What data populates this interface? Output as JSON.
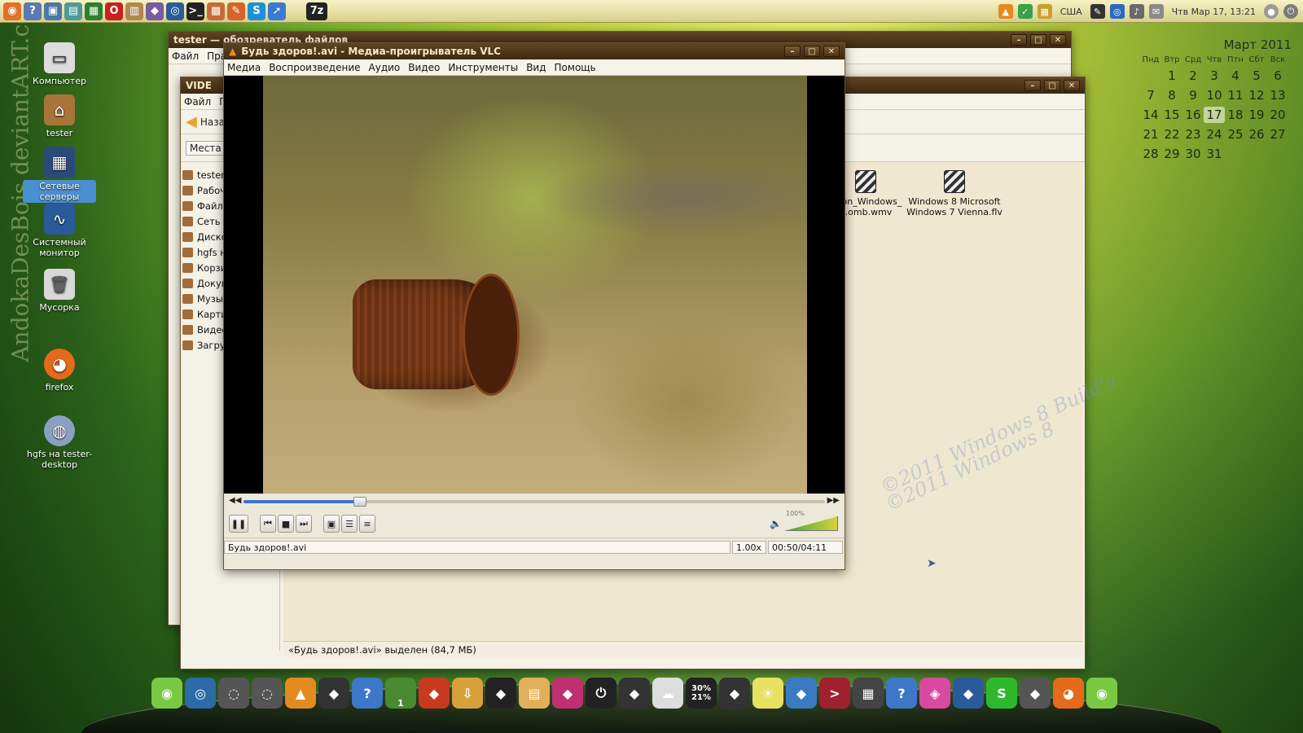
{
  "desktop": {
    "watermark": "AndokaDesBois deviantART.com",
    "diagonal_watermark_1": "©2011 Windows 8 Build's",
    "diagonal_watermark_2": "©2011 Windows 8",
    "icons": [
      {
        "label": "Компьютер",
        "icon": "computer-icon"
      },
      {
        "label": "tester",
        "icon": "home-folder-icon"
      },
      {
        "label": "Сетевые серверы",
        "icon": "network-icon"
      },
      {
        "label": "Системный монитор",
        "icon": "system-monitor-icon"
      },
      {
        "label": "Мусорка",
        "icon": "trash-icon"
      },
      {
        "label": "firefox",
        "icon": "firefox-icon"
      },
      {
        "label": "hgfs на tester-desktop",
        "icon": "network-drive-icon"
      }
    ]
  },
  "top_panel": {
    "clock": "Чтв Мар 17, 13:21",
    "keyboard_layout": "США",
    "launchers": [
      "ubuntu-icon",
      "help-icon",
      "app-icon",
      "app-icon",
      "pacman-icon",
      "opera-icon",
      "archive-icon",
      "app-icon",
      "globe-icon",
      "terminal-icon",
      "app-icon",
      "app-icon",
      "skype-icon",
      "app-icon",
      "7zip-icon"
    ],
    "launcher_7z": "7z"
  },
  "calendar": {
    "title": "Март 2011",
    "weekdays": [
      "Пнд",
      "Втр",
      "Срд",
      "Чтв",
      "Птн",
      "Сбт",
      "Вск"
    ],
    "days": [
      "",
      "1",
      "2",
      "3",
      "4",
      "5",
      "6",
      "7",
      "8",
      "9",
      "10",
      "11",
      "12",
      "13",
      "14",
      "15",
      "16",
      "17",
      "18",
      "19",
      "20",
      "21",
      "22",
      "23",
      "24",
      "25",
      "26",
      "27",
      "28",
      "29",
      "30",
      "31"
    ],
    "today": "17"
  },
  "fm_back": {
    "title": "tester — обозреватель файлов",
    "menu": [
      "Файл",
      "Пра"
    ]
  },
  "fm_front": {
    "title": "VIDE",
    "menu": [
      "Файл",
      "П"
    ],
    "back_label": "Наза",
    "places_label": "Места",
    "sidebar": [
      "tester",
      "Рабоч",
      "Файло",
      "Сеть",
      "Диско",
      "hgfs н",
      "Корзи",
      "Докум",
      "Музык",
      "Карти",
      "Видео",
      "Загру"
    ],
    "files": [
      {
        "name": "...on_Windows_ ...omb.wmv"
      },
      {
        "name": "Windows 8 Microsoft Windows 7 Vienna.flv"
      }
    ],
    "status": "«Будь здоров!.avi» выделен (84,7 МБ)"
  },
  "vlc": {
    "title": "Будь здоров!.avi - Медиа-проигрыватель VLC",
    "menu": [
      "Медиа",
      "Воспроизведение",
      "Аудио",
      "Видео",
      "Инструменты",
      "Вид",
      "Помощь"
    ],
    "file_name": "Будь здоров!.avi",
    "speed": "1.00x",
    "time": "00:50/04:11",
    "progress": 0.2,
    "volume_label": "100%",
    "volume": 1.0
  },
  "dock": {
    "items": [
      "ubuntu-icon",
      "globe-icon",
      "fingerprint-icon",
      "fingerprint-icon",
      "vlc-icon",
      "app-icon",
      "help-icon",
      "workspace-icon",
      "app-icon",
      "downloads-icon",
      "app-icon",
      "folder-icon",
      "app-icon",
      "power-icon",
      "app-icon",
      "weather-icon",
      "cpu-icon",
      "app-icon",
      "brightness-icon",
      "app-icon",
      "terminal-icon",
      "calculator-icon",
      "help-icon",
      "colors-icon",
      "app-icon",
      "skype-icon",
      "app-icon",
      "firefox-icon",
      "ubuntu-icon"
    ],
    "cpu_label_1": "30%",
    "cpu_label_2": "21%",
    "workspace_number": "1"
  }
}
